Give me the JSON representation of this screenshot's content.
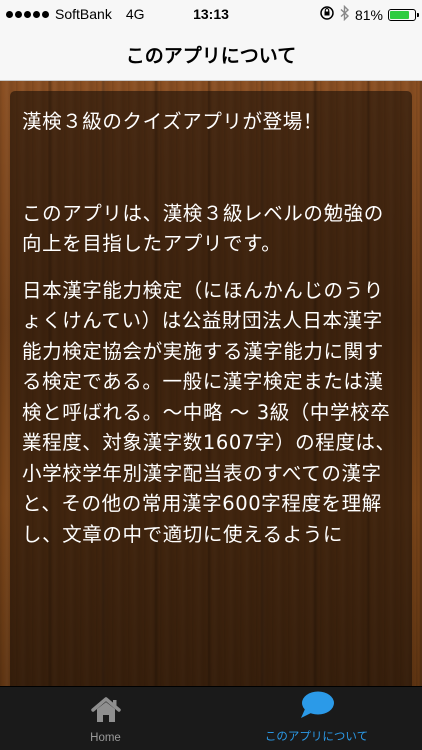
{
  "status_bar": {
    "carrier": "SoftBank",
    "network": "4G",
    "time": "13:13",
    "battery_percent": "81%",
    "battery_level": 0.81,
    "battery_color": "#2ecc40",
    "icons": [
      "signal-dots-icon",
      "orientation-lock-icon",
      "bluetooth-icon",
      "battery-icon"
    ]
  },
  "nav": {
    "title": "このアプリについて"
  },
  "content": {
    "heading": "漢検３級のクイズアプリが登場！",
    "intro": "このアプリは、漢検３級レベルの勉強の向上を目指したアプリです。",
    "body": "日本漢字能力検定（にほんかんじのうりょくけんてい）は公益財団法人日本漢字能力検定協会が実施する漢字能力に関する検定である。一般に漢字検定または漢検と呼ばれる。〜中略 〜 3級（中学校卒業程度、対象漢字数1607字）の程度は、小学校学年別漢字配当表のすべての漢字と、その他の常用漢字600字程度を理解し、文章の中で適切に使えるように"
  },
  "tabs": [
    {
      "label": "Home",
      "icon": "home-icon",
      "selected": false
    },
    {
      "label": "このアプリについて",
      "icon": "speech-bubble-icon",
      "selected": true
    }
  ],
  "colors": {
    "accent": "#2b9ae8",
    "tab_inactive": "#9a9a9a",
    "tab_bar_bg": "#1a1a1a",
    "nav_bg": "#f7f7f7"
  }
}
